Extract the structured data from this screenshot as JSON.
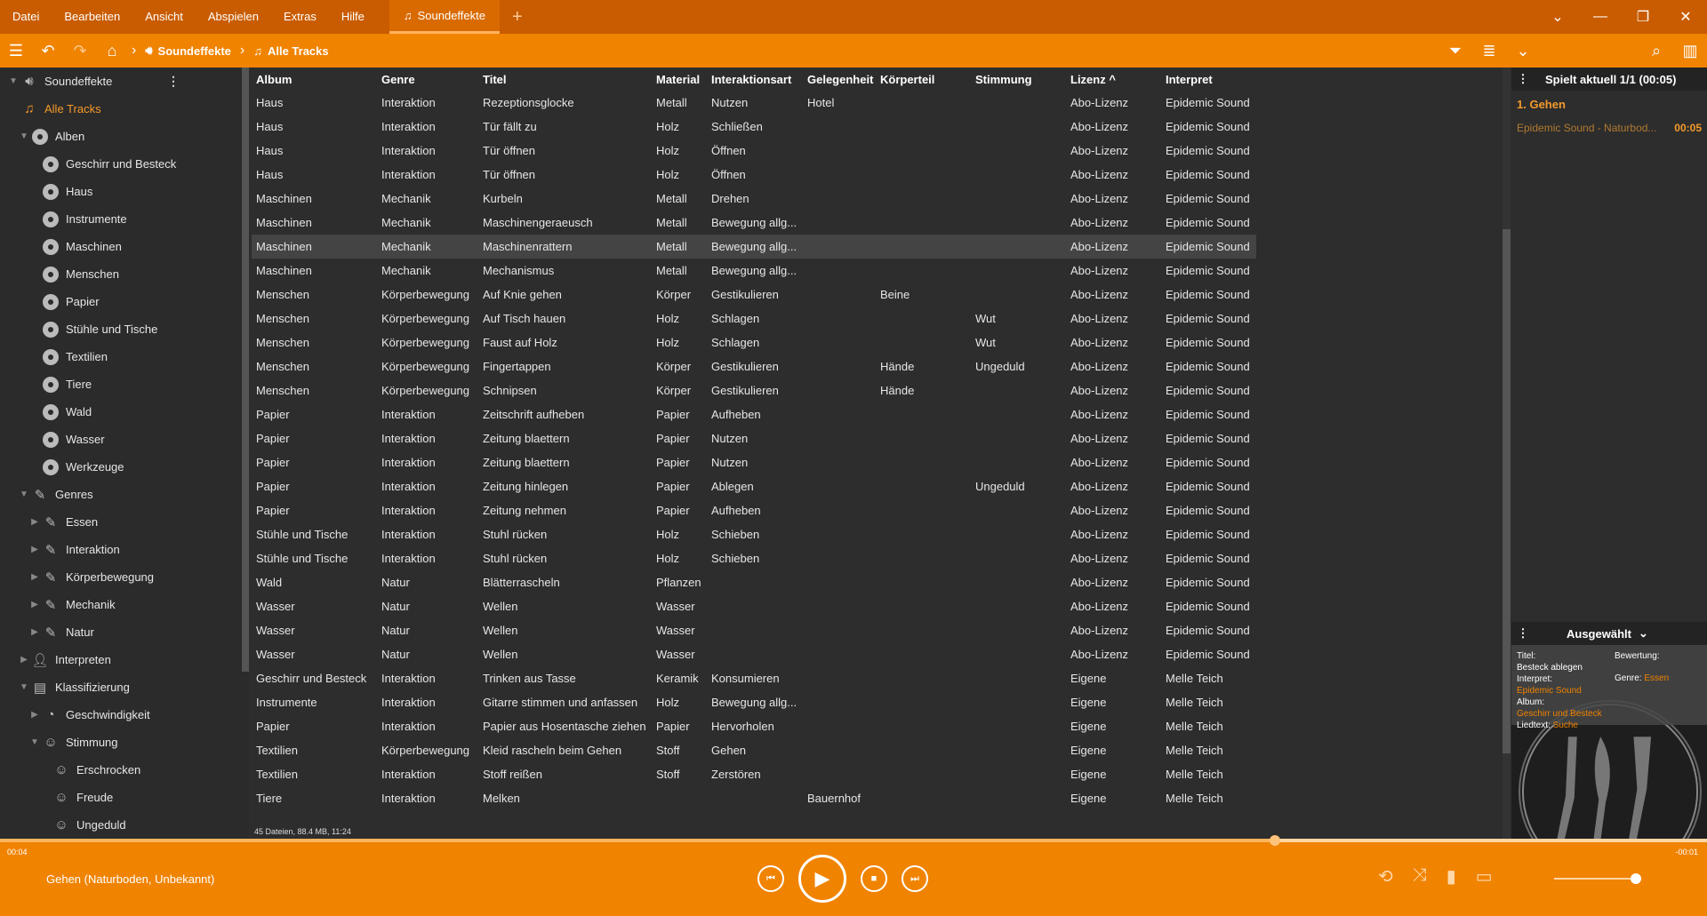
{
  "menu": [
    "Datei",
    "Bearbeiten",
    "Ansicht",
    "Abspielen",
    "Extras",
    "Hilfe"
  ],
  "tab": {
    "label": "Soundeffekte"
  },
  "toolbar": {
    "crumb1": "Soundeffekte",
    "crumb2": "Alle Tracks"
  },
  "sidebar": {
    "root": "Soundeffekte",
    "all_tracks": "Alle Tracks",
    "alben": "Alben",
    "album_items": [
      "Geschirr und Besteck",
      "Haus",
      "Instrumente",
      "Maschinen",
      "Menschen",
      "Papier",
      "Stühle und Tische",
      "Textilien",
      "Tiere",
      "Wald",
      "Wasser",
      "Werkzeuge"
    ],
    "genres": "Genres",
    "genre_items": [
      "Essen",
      "Interaktion",
      "Körperbewegung",
      "Mechanik",
      "Natur"
    ],
    "interpreten": "Interpreten",
    "klassifizierung": "Klassifizierung",
    "geschwindigkeit": "Geschwindigkeit",
    "stimmung": "Stimmung",
    "stimmung_items": [
      "Erschrocken",
      "Freude",
      "Ungeduld"
    ]
  },
  "table": {
    "columns": [
      "Album",
      "Genre",
      "Titel",
      "Material",
      "Interaktionsart",
      "Gelegenheit",
      "Körperteil",
      "Stimmung",
      "Lizenz ^",
      "Interpret"
    ],
    "rows": [
      [
        "Haus",
        "Interaktion",
        "Rezeptionsglocke",
        "Metall",
        "Nutzen",
        "Hotel",
        "",
        "",
        "Abo-Lizenz",
        "Epidemic Sound"
      ],
      [
        "Haus",
        "Interaktion",
        "Tür fällt zu",
        "Holz",
        "Schließen",
        "",
        "",
        "",
        "Abo-Lizenz",
        "Epidemic Sound"
      ],
      [
        "Haus",
        "Interaktion",
        "Tür öffnen",
        "Holz",
        "Öffnen",
        "",
        "",
        "",
        "Abo-Lizenz",
        "Epidemic Sound"
      ],
      [
        "Haus",
        "Interaktion",
        "Tür öffnen",
        "Holz",
        "Öffnen",
        "",
        "",
        "",
        "Abo-Lizenz",
        "Epidemic Sound"
      ],
      [
        "Maschinen",
        "Mechanik",
        "Kurbeln",
        "Metall",
        "Drehen",
        "",
        "",
        "",
        "Abo-Lizenz",
        "Epidemic Sound"
      ],
      [
        "Maschinen",
        "Mechanik",
        "Maschinengeraeusch",
        "Metall",
        "Bewegung allg...",
        "",
        "",
        "",
        "Abo-Lizenz",
        "Epidemic Sound"
      ],
      [
        "Maschinen",
        "Mechanik",
        "Maschinenrattern",
        "Metall",
        "Bewegung allg...",
        "",
        "",
        "",
        "Abo-Lizenz",
        "Epidemic Sound"
      ],
      [
        "Maschinen",
        "Mechanik",
        "Mechanismus",
        "Metall",
        "Bewegung allg...",
        "",
        "",
        "",
        "Abo-Lizenz",
        "Epidemic Sound"
      ],
      [
        "Menschen",
        "Körperbewegung",
        "Auf Knie gehen",
        "Körper",
        "Gestikulieren",
        "",
        "Beine",
        "",
        "Abo-Lizenz",
        "Epidemic Sound"
      ],
      [
        "Menschen",
        "Körperbewegung",
        "Auf Tisch hauen",
        "Holz",
        "Schlagen",
        "",
        "",
        "Wut",
        "Abo-Lizenz",
        "Epidemic Sound"
      ],
      [
        "Menschen",
        "Körperbewegung",
        "Faust auf Holz",
        "Holz",
        "Schlagen",
        "",
        "",
        "Wut",
        "Abo-Lizenz",
        "Epidemic Sound"
      ],
      [
        "Menschen",
        "Körperbewegung",
        "Fingertappen",
        "Körper",
        "Gestikulieren",
        "",
        "Hände",
        "Ungeduld",
        "Abo-Lizenz",
        "Epidemic Sound"
      ],
      [
        "Menschen",
        "Körperbewegung",
        "Schnipsen",
        "Körper",
        "Gestikulieren",
        "",
        "Hände",
        "",
        "Abo-Lizenz",
        "Epidemic Sound"
      ],
      [
        "Papier",
        "Interaktion",
        "Zeitschrift aufheben",
        "Papier",
        "Aufheben",
        "",
        "",
        "",
        "Abo-Lizenz",
        "Epidemic Sound"
      ],
      [
        "Papier",
        "Interaktion",
        "Zeitung blaettern",
        "Papier",
        "Nutzen",
        "",
        "",
        "",
        "Abo-Lizenz",
        "Epidemic Sound"
      ],
      [
        "Papier",
        "Interaktion",
        "Zeitung blaettern",
        "Papier",
        "Nutzen",
        "",
        "",
        "",
        "Abo-Lizenz",
        "Epidemic Sound"
      ],
      [
        "Papier",
        "Interaktion",
        "Zeitung hinlegen",
        "Papier",
        "Ablegen",
        "",
        "",
        "Ungeduld",
        "Abo-Lizenz",
        "Epidemic Sound"
      ],
      [
        "Papier",
        "Interaktion",
        "Zeitung nehmen",
        "Papier",
        "Aufheben",
        "",
        "",
        "",
        "Abo-Lizenz",
        "Epidemic Sound"
      ],
      [
        "Stühle und Tische",
        "Interaktion",
        "Stuhl rücken",
        "Holz",
        "Schieben",
        "",
        "",
        "",
        "Abo-Lizenz",
        "Epidemic Sound"
      ],
      [
        "Stühle und Tische",
        "Interaktion",
        "Stuhl rücken",
        "Holz",
        "Schieben",
        "",
        "",
        "",
        "Abo-Lizenz",
        "Epidemic Sound"
      ],
      [
        "Wald",
        "Natur",
        "Blätterrascheln",
        "Pflanzen",
        "",
        "",
        "",
        "",
        "Abo-Lizenz",
        "Epidemic Sound"
      ],
      [
        "Wasser",
        "Natur",
        "Wellen",
        "Wasser",
        "",
        "",
        "",
        "",
        "Abo-Lizenz",
        "Epidemic Sound"
      ],
      [
        "Wasser",
        "Natur",
        "Wellen",
        "Wasser",
        "",
        "",
        "",
        "",
        "Abo-Lizenz",
        "Epidemic Sound"
      ],
      [
        "Wasser",
        "Natur",
        "Wellen",
        "Wasser",
        "",
        "",
        "",
        "",
        "Abo-Lizenz",
        "Epidemic Sound"
      ],
      [
        "Geschirr und Besteck",
        "Interaktion",
        "Trinken aus Tasse",
        "Keramik",
        "Konsumieren",
        "",
        "",
        "",
        "Eigene",
        "Melle Teich"
      ],
      [
        "Instrumente",
        "Interaktion",
        "Gitarre stimmen und anfassen",
        "Holz",
        "Bewegung allg...",
        "",
        "",
        "",
        "Eigene",
        "Melle Teich"
      ],
      [
        "Papier",
        "Interaktion",
        "Papier aus Hosentasche ziehen",
        "Papier",
        "Hervorholen",
        "",
        "",
        "",
        "Eigene",
        "Melle Teich"
      ],
      [
        "Textilien",
        "Körperbewegung",
        "Kleid rascheln beim Gehen",
        "Stoff",
        "Gehen",
        "",
        "",
        "",
        "Eigene",
        "Melle Teich"
      ],
      [
        "Textilien",
        "Interaktion",
        "Stoff reißen",
        "Stoff",
        "Zerstören",
        "",
        "",
        "",
        "Eigene",
        "Melle Teich"
      ],
      [
        "Tiere",
        "Interaktion",
        "Melken",
        "",
        "",
        "Bauernhof",
        "",
        "",
        "Eigene",
        "Melle Teich"
      ]
    ],
    "selected_row": 6,
    "status": "45 Dateien, 88.4 MB, 11:24"
  },
  "playlist": {
    "header": "Spielt aktuell 1/1 (00:05)",
    "item_title": "1.  Gehen",
    "item_sub": "Epidemic Sound - Naturbod...",
    "item_time": "00:05"
  },
  "selected": {
    "header": "Ausgewählt",
    "titel_label": "Titel:",
    "titel_value": "Besteck ablegen",
    "interpret_label": "Interpret:",
    "interpret_value": "Epidemic Sound",
    "album_label": "Album:",
    "album_value": "Geschirr und Besteck",
    "liedtext_label": "Liedtext:",
    "liedtext_value": "Suche",
    "bewertung_label": "Bewertung:",
    "genre_label": "Genre:",
    "genre_value": "Essen"
  },
  "player": {
    "elapsed": "00:04",
    "remaining": "-00:01",
    "now_playing": "Gehen (Naturboden, Unbekannt)",
    "progress": 0.746
  },
  "colors": {
    "accent": "#f08300",
    "menubar": "#c95c00",
    "highlight": "#f49a2a"
  }
}
